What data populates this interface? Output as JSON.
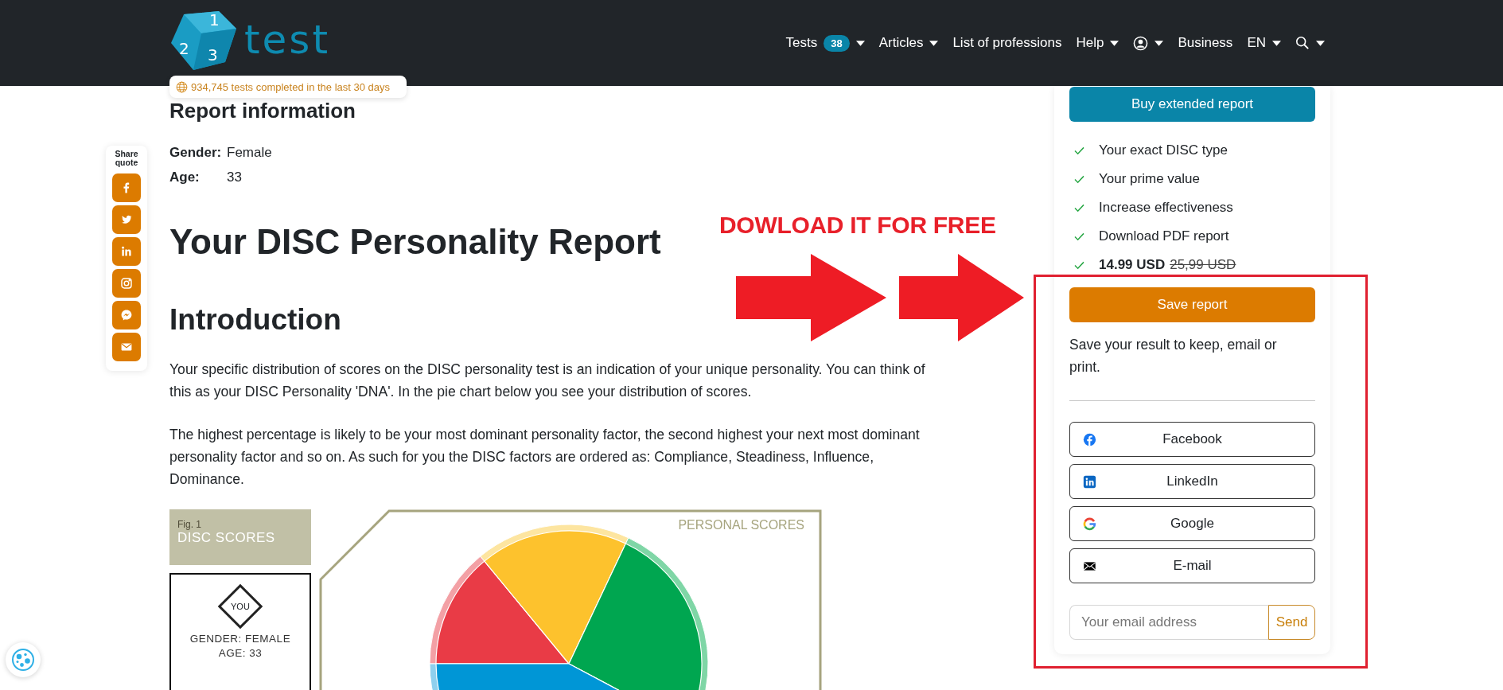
{
  "header": {
    "logo_digits": [
      "1",
      "2",
      "3"
    ],
    "logo_text": "test",
    "nav": [
      {
        "kind": "text",
        "label": "Tests",
        "badge": "38",
        "dropdown": true
      },
      {
        "kind": "text",
        "label": "Articles",
        "dropdown": true
      },
      {
        "kind": "text",
        "label": "List of professions",
        "dropdown": false
      },
      {
        "kind": "text",
        "label": "Help",
        "dropdown": true
      },
      {
        "kind": "account",
        "dropdown": true
      },
      {
        "kind": "text",
        "label": "Business",
        "dropdown": false
      },
      {
        "kind": "text",
        "label": "EN",
        "dropdown": true
      },
      {
        "kind": "search",
        "dropdown": true
      }
    ]
  },
  "stats_badge": "934,745 tests completed in the last 30 days",
  "share": {
    "label": "Share quote",
    "buttons": [
      {
        "kind": "facebook"
      },
      {
        "kind": "twitter"
      },
      {
        "kind": "linkedin"
      },
      {
        "kind": "instagram"
      },
      {
        "kind": "messenger"
      },
      {
        "kind": "email"
      }
    ]
  },
  "report_info": {
    "title": "Report information",
    "fields": [
      {
        "label": "Gender:",
        "value": "Female"
      },
      {
        "label": "Age:",
        "value": "33"
      }
    ]
  },
  "title": "Your DISC Personality Report",
  "introduction": {
    "heading": "Introduction",
    "paragraphs": [
      "Your specific distribution of scores on the DISC personality test is an indication of your unique personality. You can think of this as your DISC Personality 'DNA'. In the pie chart below you see your distribution of scores.",
      "The highest percentage is likely to be your most dominant personality factor, the second highest your next most dominant personality factor and so on. As such for you the DISC factors are ordered as: Compliance, Steadiness, Influence, Dominance."
    ]
  },
  "figure": {
    "fig_label": "Fig. 1",
    "fig_title": "DISC SCORES",
    "you": "YOU",
    "gender": "GENDER: FEMALE",
    "age": "AGE: 33",
    "chart_title": "PERSONAL SCORES"
  },
  "sidebar": {
    "buy_button": "Buy extended report",
    "features": [
      "Your exact DISC type",
      "Your prime value",
      "Increase effectiveness",
      "Download PDF report"
    ],
    "price": "14.99 USD",
    "old_price": "25,99 USD",
    "save_button": "Save report",
    "save_text": "Save your result to keep, email or print.",
    "share_buttons": [
      {
        "kind": "facebook",
        "label": "Facebook"
      },
      {
        "kind": "linkedin",
        "label": "LinkedIn"
      },
      {
        "kind": "google",
        "label": "Google"
      },
      {
        "kind": "email",
        "label": "E-mail"
      }
    ],
    "email": {
      "placeholder": "Your email address",
      "button": "Send"
    }
  },
  "annotation": {
    "text": "DOWLOAD IT FOR FREE"
  }
}
